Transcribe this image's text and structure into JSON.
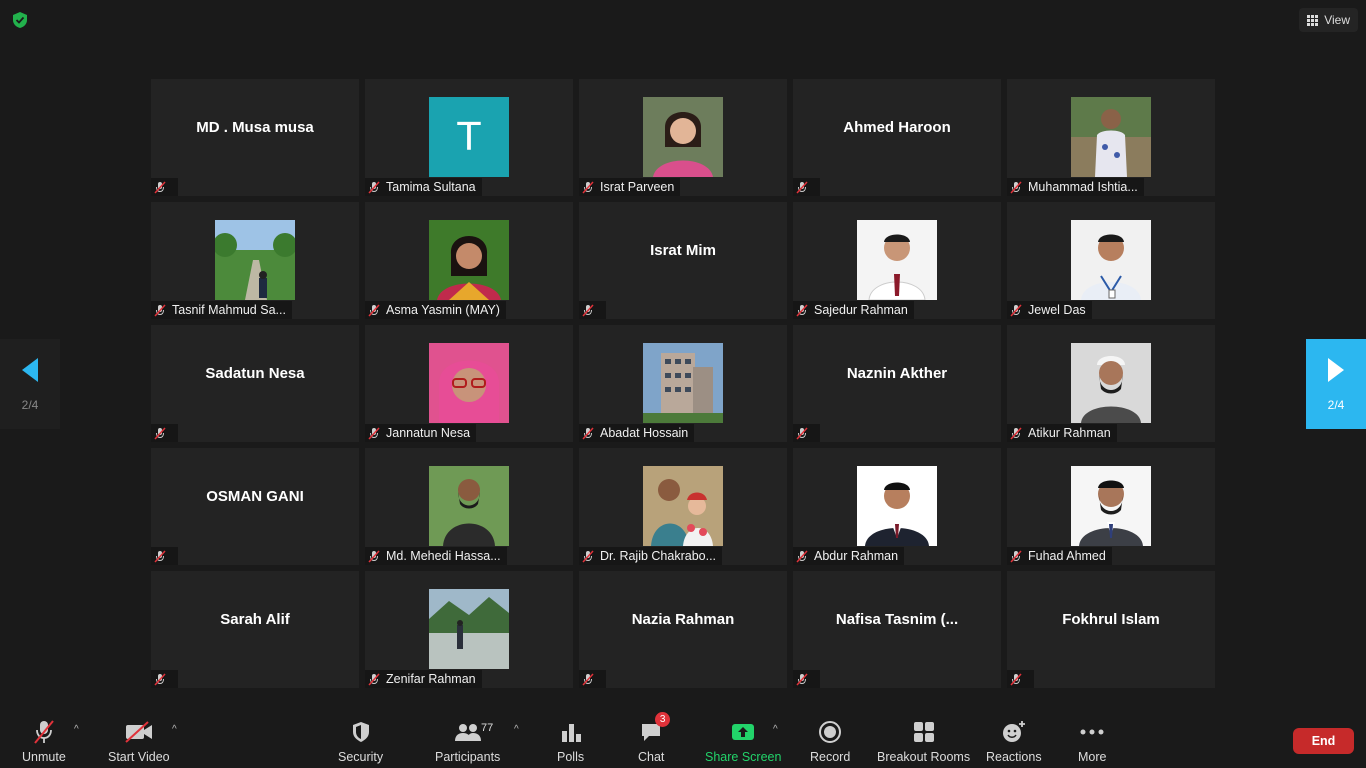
{
  "top": {
    "view_label": "View",
    "security_color": "#22b14c"
  },
  "pagination": {
    "left_page": "2/4",
    "right_page": "2/4",
    "accent": "#2cb7f0"
  },
  "participants": [
    {
      "name": "MD . Musa musa",
      "label": "",
      "avatar": "none"
    },
    {
      "name": "",
      "label": "Tamima Sultana",
      "avatar": "letter",
      "letter": "T"
    },
    {
      "name": "",
      "label": "Israt Parveen",
      "avatar": "photo-woman-pink"
    },
    {
      "name": "Ahmed Haroon",
      "label": "",
      "avatar": "none"
    },
    {
      "name": "",
      "label": "Muhammad Ishtia...",
      "avatar": "photo-man-floral-shirt"
    },
    {
      "name": "",
      "label": "Tasnif Mahmud Sa...",
      "avatar": "photo-garden-path"
    },
    {
      "name": "",
      "label": "Asma Yasmin (MAY)",
      "avatar": "photo-woman-green"
    },
    {
      "name": "Israt Mim",
      "label": "",
      "avatar": "none"
    },
    {
      "name": "",
      "label": "Sajedur Rahman",
      "avatar": "photo-man-white-shirt"
    },
    {
      "name": "",
      "label": "Jewel Das",
      "avatar": "photo-man-id-card"
    },
    {
      "name": "Sadatun Nesa",
      "label": "",
      "avatar": "none"
    },
    {
      "name": "",
      "label": "Jannatun Nesa",
      "avatar": "photo-woman-hijab-glasses"
    },
    {
      "name": "",
      "label": "Abadat Hossain",
      "avatar": "photo-building"
    },
    {
      "name": "Naznin Akther",
      "label": "",
      "avatar": "none"
    },
    {
      "name": "",
      "label": "Atikur Rahman",
      "avatar": "photo-man-cap-beard"
    },
    {
      "name": "OSMAN GANI",
      "label": "",
      "avatar": "none"
    },
    {
      "name": "",
      "label": "Md. Mehedi Hassa...",
      "avatar": "photo-man-outdoor-beard"
    },
    {
      "name": "",
      "label": "Dr. Rajib Chakrabo...",
      "avatar": "photo-man-with-baby"
    },
    {
      "name": "",
      "label": "Abdur Rahman",
      "avatar": "photo-man-suit"
    },
    {
      "name": "",
      "label": "Fuhad Ahmed",
      "avatar": "photo-man-suit-beard"
    },
    {
      "name": "Sarah Alif",
      "label": "",
      "avatar": "none"
    },
    {
      "name": "",
      "label": "Zenifar Rahman",
      "avatar": "photo-river-landscape"
    },
    {
      "name": "Nazia Rahman",
      "label": "",
      "avatar": "none"
    },
    {
      "name": "Nafisa Tasnim  (...",
      "label": "",
      "avatar": "none"
    },
    {
      "name": "Fokhrul Islam",
      "label": "",
      "avatar": "none"
    }
  ],
  "toolbar": {
    "unmute": "Unmute",
    "start_video": "Start Video",
    "security": "Security",
    "participants": "Participants",
    "participants_count": "77",
    "polls": "Polls",
    "chat": "Chat",
    "chat_badge": "3",
    "share_screen": "Share Screen",
    "record": "Record",
    "breakout_rooms": "Breakout Rooms",
    "reactions": "Reactions",
    "more": "More",
    "end": "End"
  },
  "icons": {
    "mute": "muted-mic-icon",
    "video_off": "video-off-icon",
    "shield": "shield-icon",
    "participants": "participants-icon",
    "polls": "polls-icon",
    "chat": "chat-icon",
    "share": "share-screen-icon",
    "record": "record-icon",
    "breakout": "breakout-rooms-icon",
    "reactions": "reactions-icon",
    "more": "more-icon",
    "grid": "grid-view-icon"
  }
}
